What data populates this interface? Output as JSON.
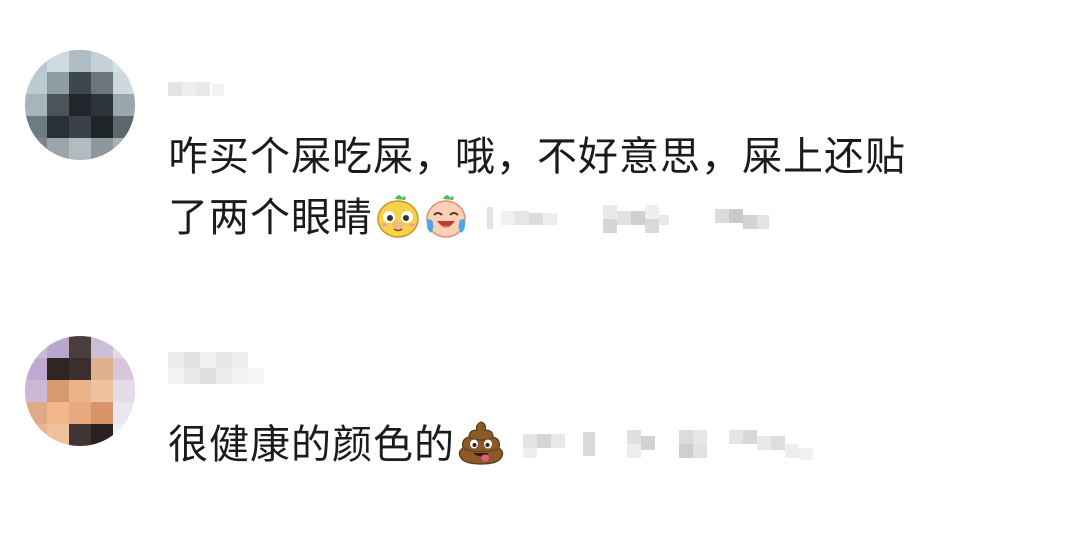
{
  "comments": [
    {
      "text_line1": "咋买个屎吃屎，哦，不好意思，屎上还贴",
      "text_line2": "了两个眼睛",
      "emojis": [
        "yellow-dog-face-emoji",
        "laughing-crying-face-emoji"
      ]
    },
    {
      "text_line1": "很健康的颜色的",
      "emojis": [
        "poop-emoji"
      ]
    }
  ]
}
